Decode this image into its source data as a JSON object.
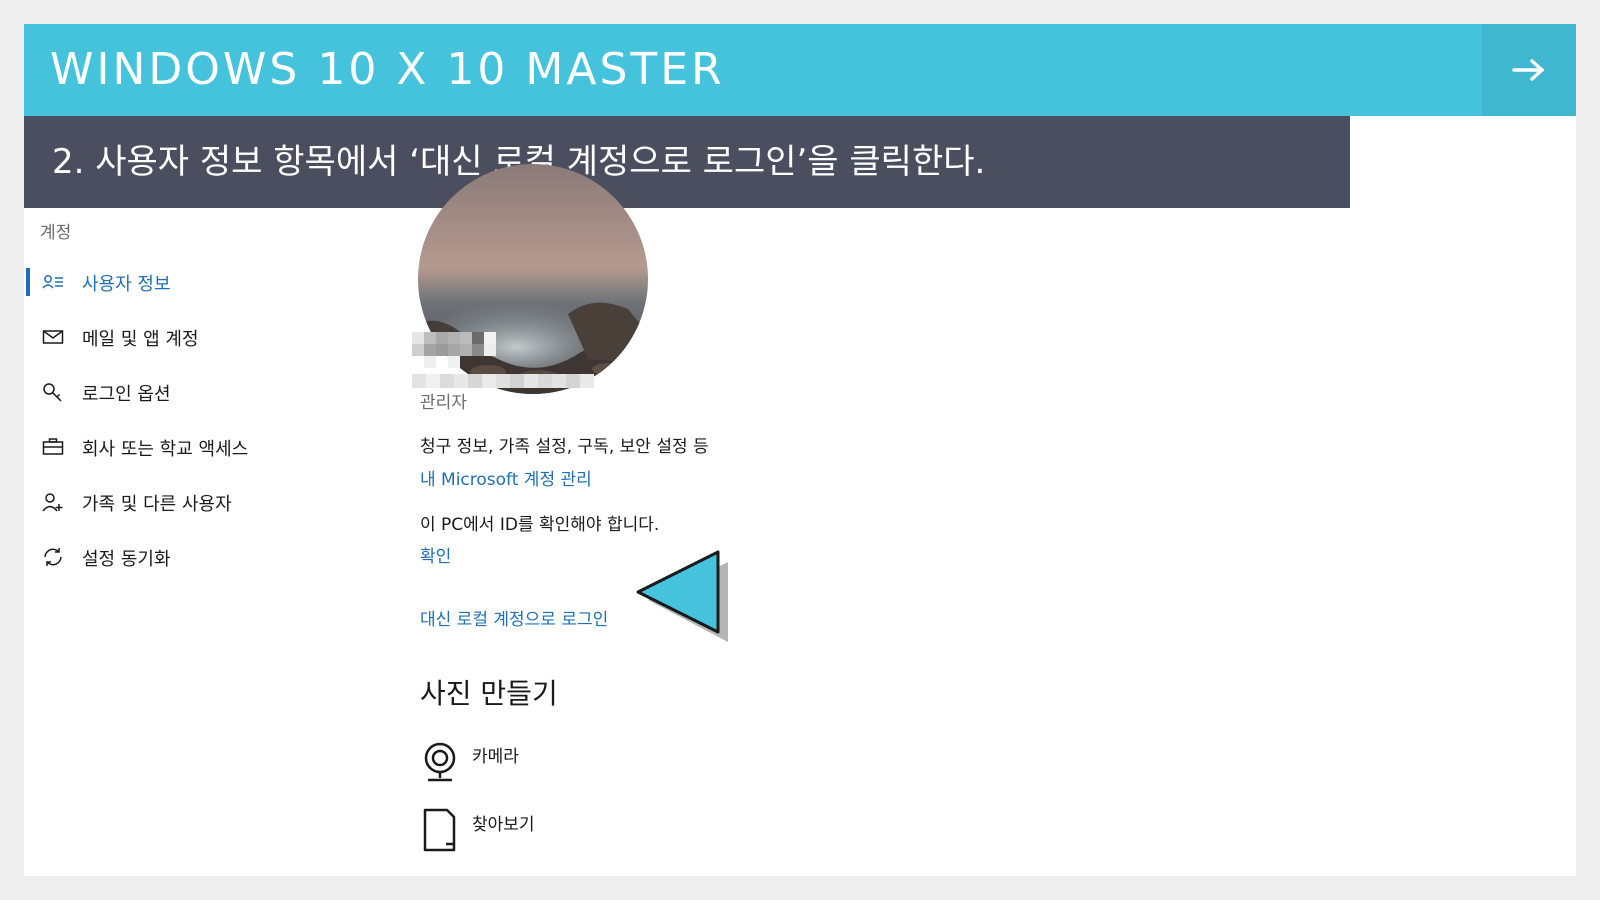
{
  "banner": {
    "title": "WINDOWS 10 X 10 MASTER",
    "next_icon": "arrow-right-icon",
    "background": "#45c3dc"
  },
  "step": {
    "text": "2. 사용자 정보 항목에서 ‘대신 로컬 계정으로 로그인’을 클릭한다.",
    "background": "#4a4e5f"
  },
  "sidebar": {
    "heading": "계정",
    "items": [
      {
        "label": "사용자 정보",
        "icon": "user-info-icon",
        "active": true
      },
      {
        "label": "메일 및 앱 계정",
        "icon": "mail-icon",
        "active": false
      },
      {
        "label": "로그인 옵션",
        "icon": "key-icon",
        "active": false
      },
      {
        "label": "회사 또는 학교 액세스",
        "icon": "briefcase-icon",
        "active": false
      },
      {
        "label": "가족 및 다른 사용자",
        "icon": "add-person-icon",
        "active": false
      },
      {
        "label": "설정 동기화",
        "icon": "sync-icon",
        "active": false
      }
    ],
    "accent": "#1f6fb8"
  },
  "profile": {
    "role": "관리자",
    "billing_text": "청구 정보, 가족 설정, 구독, 보안 설정 등",
    "manage_link": "내 Microsoft 계정 관리",
    "verify_text": "이 PC에서 ID를 확인해야 합니다.",
    "verify_link": "확인",
    "local_account_link": "대신 로컬 계정으로 로그인"
  },
  "create_photo": {
    "title": "사진 만들기",
    "options": [
      {
        "label": "카메라",
        "icon": "webcam-icon"
      },
      {
        "label": "찾아보기",
        "icon": "browse-file-icon"
      }
    ]
  },
  "annotation": {
    "pointer_icon": "triangle-pointer-icon",
    "color": "#45c3dc"
  }
}
